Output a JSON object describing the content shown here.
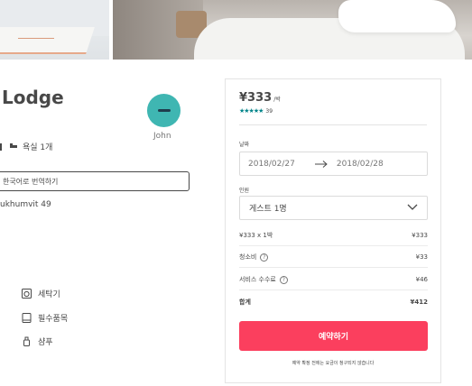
{
  "listing": {
    "title": "Lodge",
    "host_name": "John",
    "bath_label": "욕실 1개",
    "translate_label": "한국어로 번역하기",
    "address": "ukhumvit 49"
  },
  "amenities": [
    {
      "label": "세탁기",
      "icon": "washer-icon"
    },
    {
      "label": "필수품목",
      "icon": "essentials-icon"
    },
    {
      "label": "샴푸",
      "icon": "shampoo-icon"
    }
  ],
  "booking": {
    "price": "¥333",
    "per_night": "/박",
    "stars": "★★★★★",
    "rating_value": 5,
    "review_count": "39",
    "date_label": "날짜",
    "checkin": "2018/02/27",
    "checkout": "2018/02/28",
    "guests_label": "인원",
    "guests_value": "게스트 1명",
    "fees": {
      "nights_label": "¥333 x 1박",
      "nights_amount": "¥333",
      "cleaning_label": "청소비",
      "cleaning_amount": "¥33",
      "service_label": "서비스 수수료",
      "service_amount": "¥46",
      "total_label": "합계",
      "total_amount": "¥412"
    },
    "reserve_label": "예약하기",
    "no_charge_note": "예약 확정 전에는 요금이 청구되지 않습니다"
  },
  "colors": {
    "accent": "#fb3f5e",
    "rating": "#008489",
    "avatar": "#3fb6b2"
  }
}
